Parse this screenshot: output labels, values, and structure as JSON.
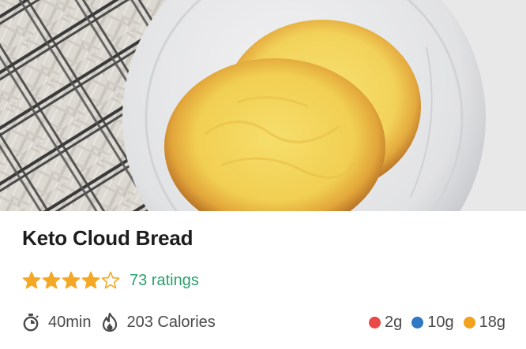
{
  "recipe": {
    "title": "Keto Cloud Bread",
    "rating_stars": 4,
    "rating_max": 5,
    "ratings_text": "73 ratings",
    "time": "40min",
    "calories": "203 Calories"
  },
  "macros": [
    {
      "value": "2g",
      "color": "#ea4848"
    },
    {
      "value": "10g",
      "color": "#2f78c4"
    },
    {
      "value": "18g",
      "color": "#f2a21c"
    }
  ],
  "colors": {
    "star": "#f4a825",
    "link": "#2aa06b",
    "title": "#1d1d1d",
    "meta": "#4a4a4a"
  },
  "icons": {
    "time": "stopwatch-icon",
    "calories": "flame-icon",
    "rating": "star-icon"
  }
}
